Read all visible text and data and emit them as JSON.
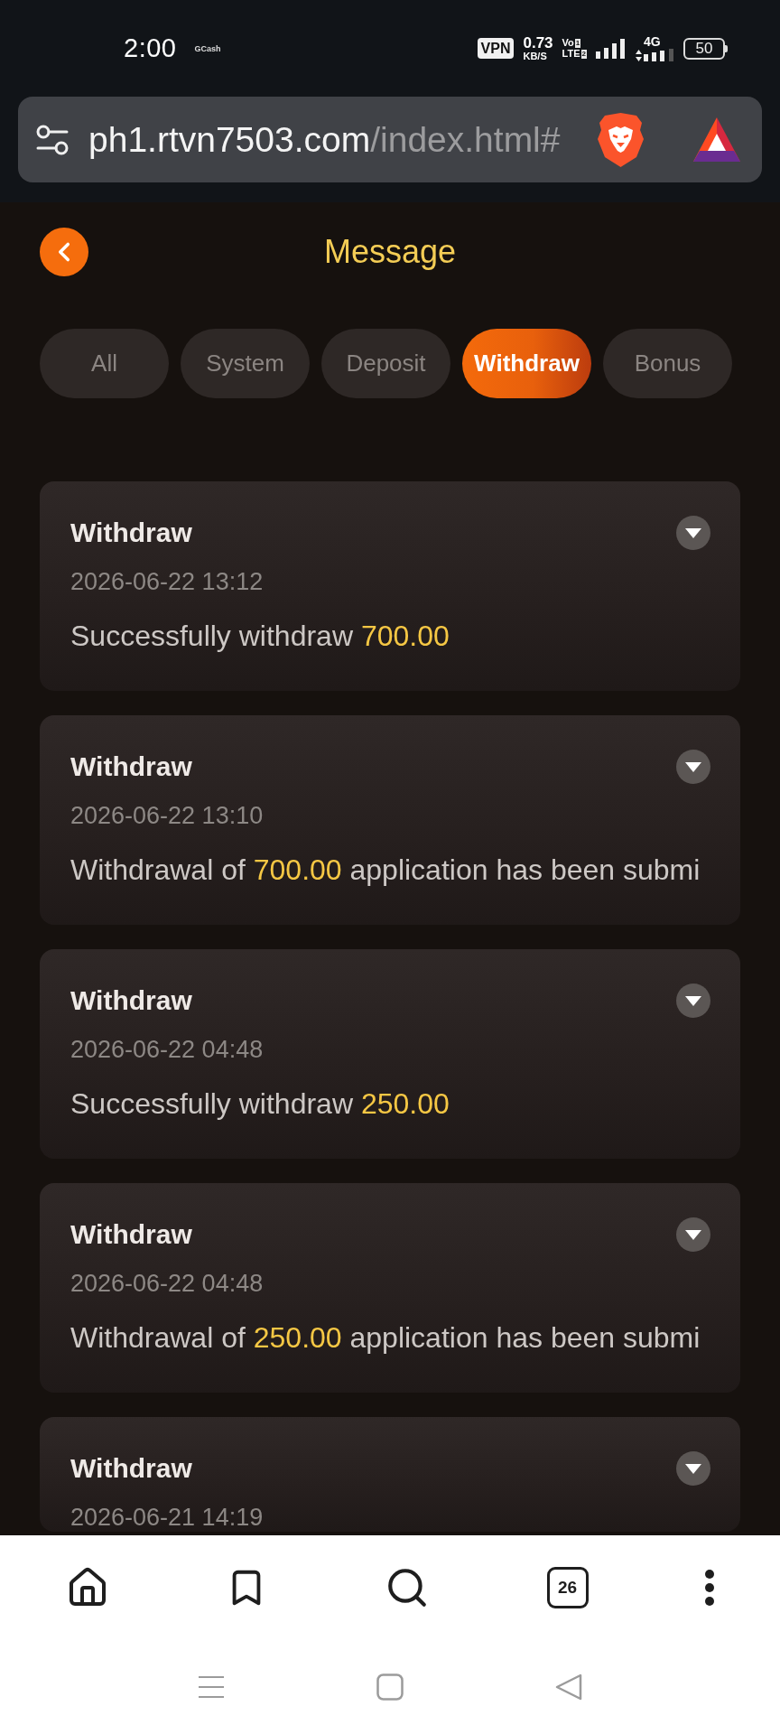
{
  "status_bar": {
    "time": "2:00",
    "notification": "GCash",
    "vpn": "VPN",
    "speed": "0.73",
    "speed_unit": "KB/S",
    "volte": "Vo",
    "lte": "LTE",
    "sim_1": "1",
    "sim_2": "2",
    "network": "4G",
    "battery": "50"
  },
  "address_bar": {
    "domain": "ph1.rtvn7503.com",
    "path": "/index.html#"
  },
  "header": {
    "title": "Message"
  },
  "tabs": [
    {
      "label": "All",
      "selected": false
    },
    {
      "label": "System",
      "selected": false
    },
    {
      "label": "Deposit",
      "selected": false
    },
    {
      "label": "Withdraw",
      "selected": true
    },
    {
      "label": "Bonus",
      "selected": false
    }
  ],
  "messages": [
    {
      "title": "Withdraw",
      "date": "2026-06-22 13:12",
      "text": {
        "before": "Successfully withdraw ",
        "amount": "700.00"
      },
      "expanded": false
    },
    {
      "title": "Withdraw",
      "date": "2026-06-22 13:10",
      "text": {
        "before": "Withdrawal of ",
        "amount": "700.00",
        "after": " application has been submi"
      },
      "expanded": false
    },
    {
      "title": "Withdraw",
      "date": "2026-06-22 04:48",
      "text": {
        "before": "Successfully withdraw ",
        "amount": "250.00"
      },
      "expanded": false
    },
    {
      "title": "Withdraw",
      "date": "2026-06-22 04:48",
      "text": {
        "before": "Withdrawal of ",
        "amount": "250.00",
        "after": " application has been submi"
      },
      "expanded": false
    },
    {
      "title": "Withdraw",
      "date": "2026-06-21 14:19",
      "expanded": false
    }
  ],
  "browser_toolbar": {
    "tab_count": "26"
  }
}
